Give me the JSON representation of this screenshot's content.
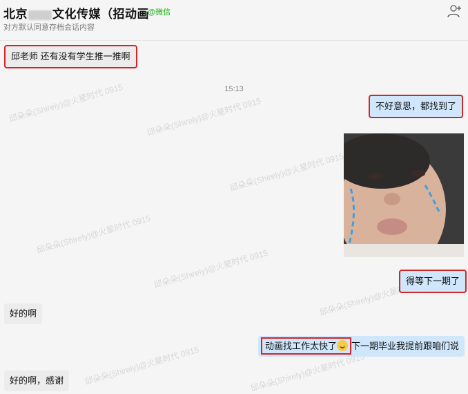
{
  "header": {
    "title_left": "北京",
    "title_right": "文化传媒（招动画",
    "source": "@微信",
    "subtitle": "对方默认同意存档会话内容"
  },
  "messages": {
    "m1": "邱老师 还有没有学生推一推啊",
    "time": "15:13",
    "m2": "不好意思，都找到了",
    "m3": "得等下一期了",
    "m4": "好的啊",
    "m5_part1": "动画找工作太快了",
    "m5_part2": "下一期毕业我提前跟咱们说",
    "m6": "好的啊，感谢"
  },
  "watermark": "邱朵朵(Shirely)@火星时代 0915",
  "colors": {
    "accent": "#1aad19",
    "highlight": "#d42424",
    "outgoing": "#cfe6fb",
    "incoming": "#ececec"
  },
  "icons": {
    "add_user": "add-user-icon",
    "emoji": "grin-sweat-emoji-icon"
  }
}
